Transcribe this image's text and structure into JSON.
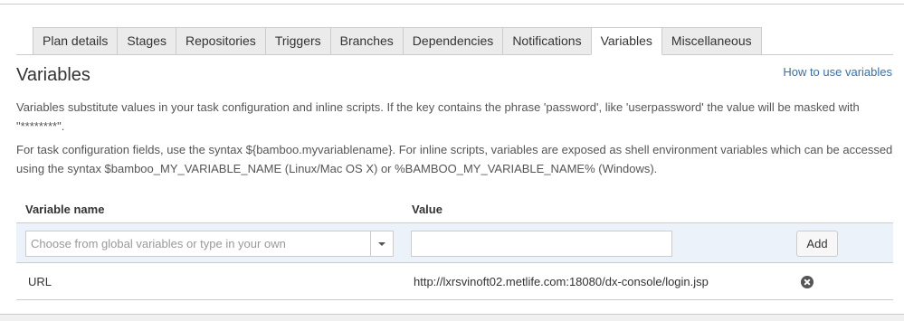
{
  "tabs": [
    {
      "label": "Plan details",
      "active": false
    },
    {
      "label": "Stages",
      "active": false
    },
    {
      "label": "Repositories",
      "active": false
    },
    {
      "label": "Triggers",
      "active": false
    },
    {
      "label": "Branches",
      "active": false
    },
    {
      "label": "Dependencies",
      "active": false
    },
    {
      "label": "Notifications",
      "active": false
    },
    {
      "label": "Variables",
      "active": true
    },
    {
      "label": "Miscellaneous",
      "active": false
    }
  ],
  "section": {
    "title": "Variables",
    "help_link": "How to use variables",
    "description_1": "Variables substitute values in your task configuration and inline scripts. If the key contains the phrase 'password', like 'userpassword' the value will be masked with \"********\".",
    "description_2": "For task configuration fields, use the syntax ${bamboo.myvariablename}. For inline scripts, variables are exposed as shell environment variables which can be accessed using the syntax $bamboo_MY_VARIABLE_NAME (Linux/Mac OS X) or %BAMBOO_MY_VARIABLE_NAME% (Windows)."
  },
  "table": {
    "headers": {
      "name": "Variable name",
      "value": "Value"
    },
    "new_variable": {
      "name_placeholder": "Choose from global variables or type in your own",
      "value": "",
      "add_label": "Add"
    },
    "rows": [
      {
        "name": "URL",
        "value": "http://lxrsvinoft02.metlife.com:18080/dx-console/login.jsp"
      }
    ]
  },
  "colors": {
    "link": "#3572b0",
    "add_row_bg": "#ebf2f9",
    "tab_inactive_bg": "#ebebeb",
    "border": "#cccccc"
  },
  "icons": {
    "combo_trigger": "chevron-down-icon",
    "row_delete": "close-circle-icon"
  }
}
